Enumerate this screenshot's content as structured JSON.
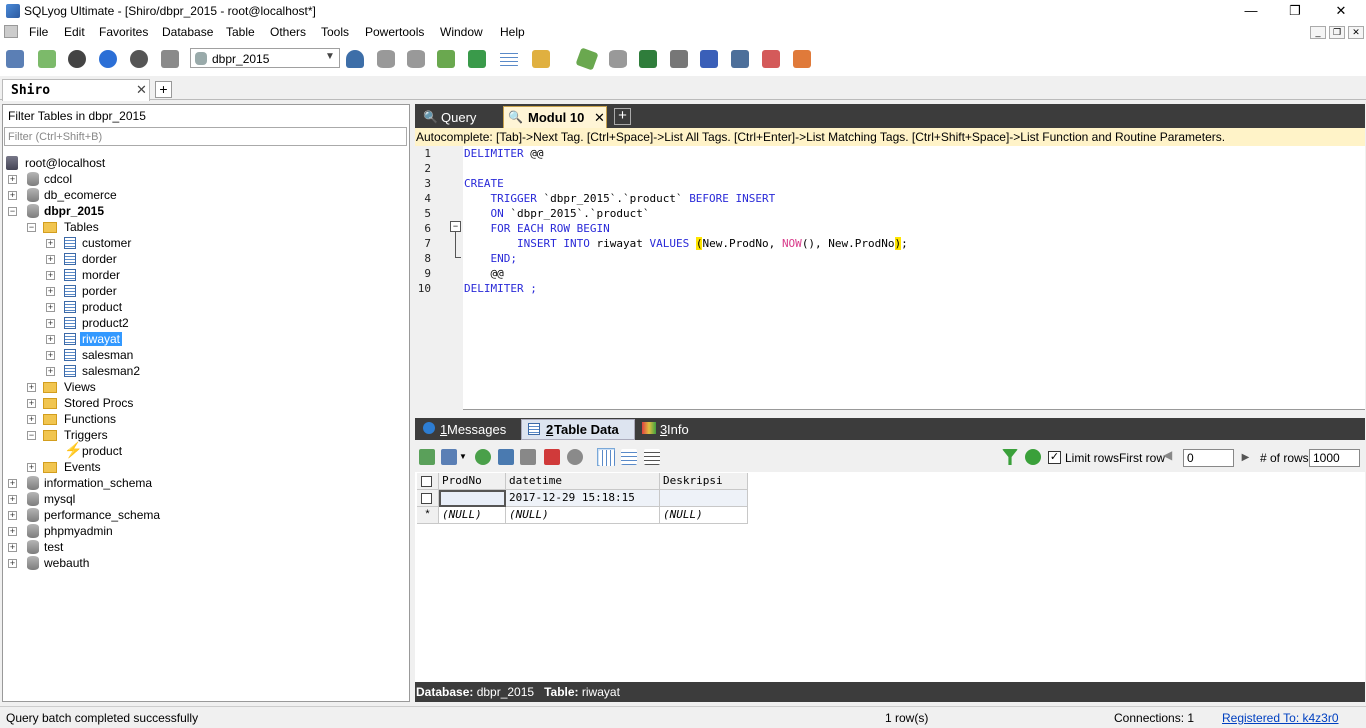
{
  "window": {
    "title": "SQLyog Ultimate - [Shiro/dbpr_2015 - root@localhost*]",
    "min": "—",
    "max": "❐",
    "close": "✕"
  },
  "menu": [
    "File",
    "Edit",
    "Favorites",
    "Database",
    "Table",
    "Others",
    "Tools",
    "Powertools",
    "Window",
    "Help"
  ],
  "toolbar": {
    "database_select": "dbpr_2015"
  },
  "connection_tab": {
    "label": "Shiro",
    "close": "✕",
    "add": "+"
  },
  "object_browser": {
    "filter_label": "Filter Tables in dbpr_2015",
    "filter_placeholder": "Filter (Ctrl+Shift+B)",
    "server": "root@localhost",
    "databases_top": [
      "cdcol",
      "db_ecomerce"
    ],
    "active_db": "dbpr_2015",
    "tables_folder": "Tables",
    "tables": [
      "customer",
      "dorder",
      "morder",
      "porder",
      "product",
      "product2",
      "riwayat",
      "salesman",
      "salesman2"
    ],
    "folders": [
      "Views",
      "Stored Procs",
      "Functions"
    ],
    "triggers_folder": "Triggers",
    "trigger": "product",
    "events_folder": "Events",
    "databases_bottom": [
      "information_schema",
      "mysql",
      "performance_schema",
      "phpmyadmin",
      "test",
      "webauth"
    ]
  },
  "editor_tabs": {
    "query": "Query",
    "modul": "Modul 10",
    "add": "+"
  },
  "autocomplete_hint": "Autocomplete: [Tab]->Next Tag. [Ctrl+Space]->List All Tags. [Ctrl+Enter]->List Matching Tags. [Ctrl+Shift+Space]->List Function and Routine Parameters.",
  "code_line_numbers": [
    "1",
    "2",
    "3",
    "4",
    "5",
    "6",
    "7",
    "8",
    "9",
    "10"
  ],
  "code": {
    "l1_kw": "DELIMITER",
    "l1_rest": " @@",
    "l3_kw": "CREATE",
    "l4_kw1": "    TRIGGER",
    "l4_mid": " `dbpr_2015`.`product` ",
    "l4_kw2": "BEFORE INSERT",
    "l5_kw": "    ON",
    "l5_rest": " `dbpr_2015`.`product`",
    "l6_kw": "    FOR EACH ROW BEGIN",
    "l7_kw1": "        INSERT INTO",
    "l7_mid": " riwayat ",
    "l7_kw2": "VALUES",
    "l7_sp": " ",
    "l7_p1": "(",
    "l7_a": "New.ProdNo, ",
    "l7_fn": "NOW",
    "l7_b": "(), New.ProdNo",
    "l7_p2": ")",
    "l7_end": ";",
    "l8_kw": "    END;",
    "l9": "    @@",
    "l10_kw": "DELIMITER ;"
  },
  "result_tabs": {
    "messages_num": "1",
    "messages": " Messages",
    "data_num": "2",
    "data": " Table Data",
    "info_num": "3",
    "info": " Info"
  },
  "result_toolbar": {
    "limit_rows_label": "Limit rows",
    "limit_rows_checked": "✓",
    "first_row_label": "First row",
    "first_row_value": "0",
    "num_rows_label": "# of rows",
    "num_rows_value": "1000"
  },
  "grid": {
    "columns": [
      "ProdNo",
      "datetime",
      "Deskripsi"
    ],
    "row1": [
      "",
      "2017-12-29 15:18:15",
      ""
    ],
    "new_row_marker": "*",
    "row2": [
      "(NULL)",
      "(NULL)",
      "(NULL)"
    ]
  },
  "info_bar": {
    "db_label": "Database:",
    "db_value": " dbpr_2015",
    "table_label": "Table:",
    "table_value": " riwayat"
  },
  "status": {
    "message": "Query batch completed successfully",
    "rows": "1 row(s)",
    "connections": "Connections: 1",
    "registered": "Registered To: k4z3r0"
  },
  "colors": {
    "accent": "#3399ff",
    "keyword": "#2a2ad8",
    "function": "#d83a8a",
    "bracket_highlight": "#ffe500",
    "autocomplete_bg": "#fff3c8",
    "dark_tabbar": "#3c3c3c"
  }
}
